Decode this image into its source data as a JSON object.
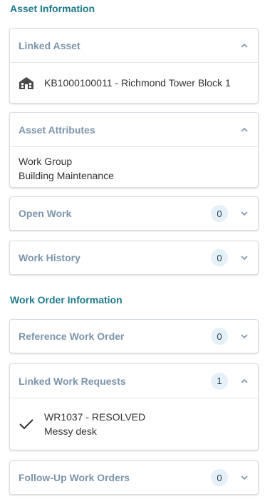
{
  "asset_section": {
    "title": "Asset Information"
  },
  "linked_asset": {
    "title": "Linked Asset",
    "icon": "building-icon",
    "value": "KB1000100011 - Richmond Tower Block 1"
  },
  "asset_attributes": {
    "title": "Asset Attributes",
    "label": "Work Group",
    "value": "Building Maintenance"
  },
  "open_work": {
    "title": "Open Work",
    "count": "0"
  },
  "work_history": {
    "title": "Work History",
    "count": "0"
  },
  "work_order_section": {
    "title": "Work Order Information"
  },
  "reference_work_order": {
    "title": "Reference Work Order",
    "count": "0"
  },
  "linked_work_requests": {
    "title": "Linked Work Requests",
    "count": "1",
    "item": {
      "icon": "check-icon",
      "title": "WR1037 - RESOLVED",
      "subtitle": "Messy desk"
    }
  },
  "follow_up_work_orders": {
    "title": "Follow-Up Work Orders",
    "count": "0"
  },
  "colors": {
    "section_title": "#1f7a8c",
    "card_title": "#7b95ab",
    "badge_bg": "#e4f1f8",
    "border": "#d6dde3"
  }
}
